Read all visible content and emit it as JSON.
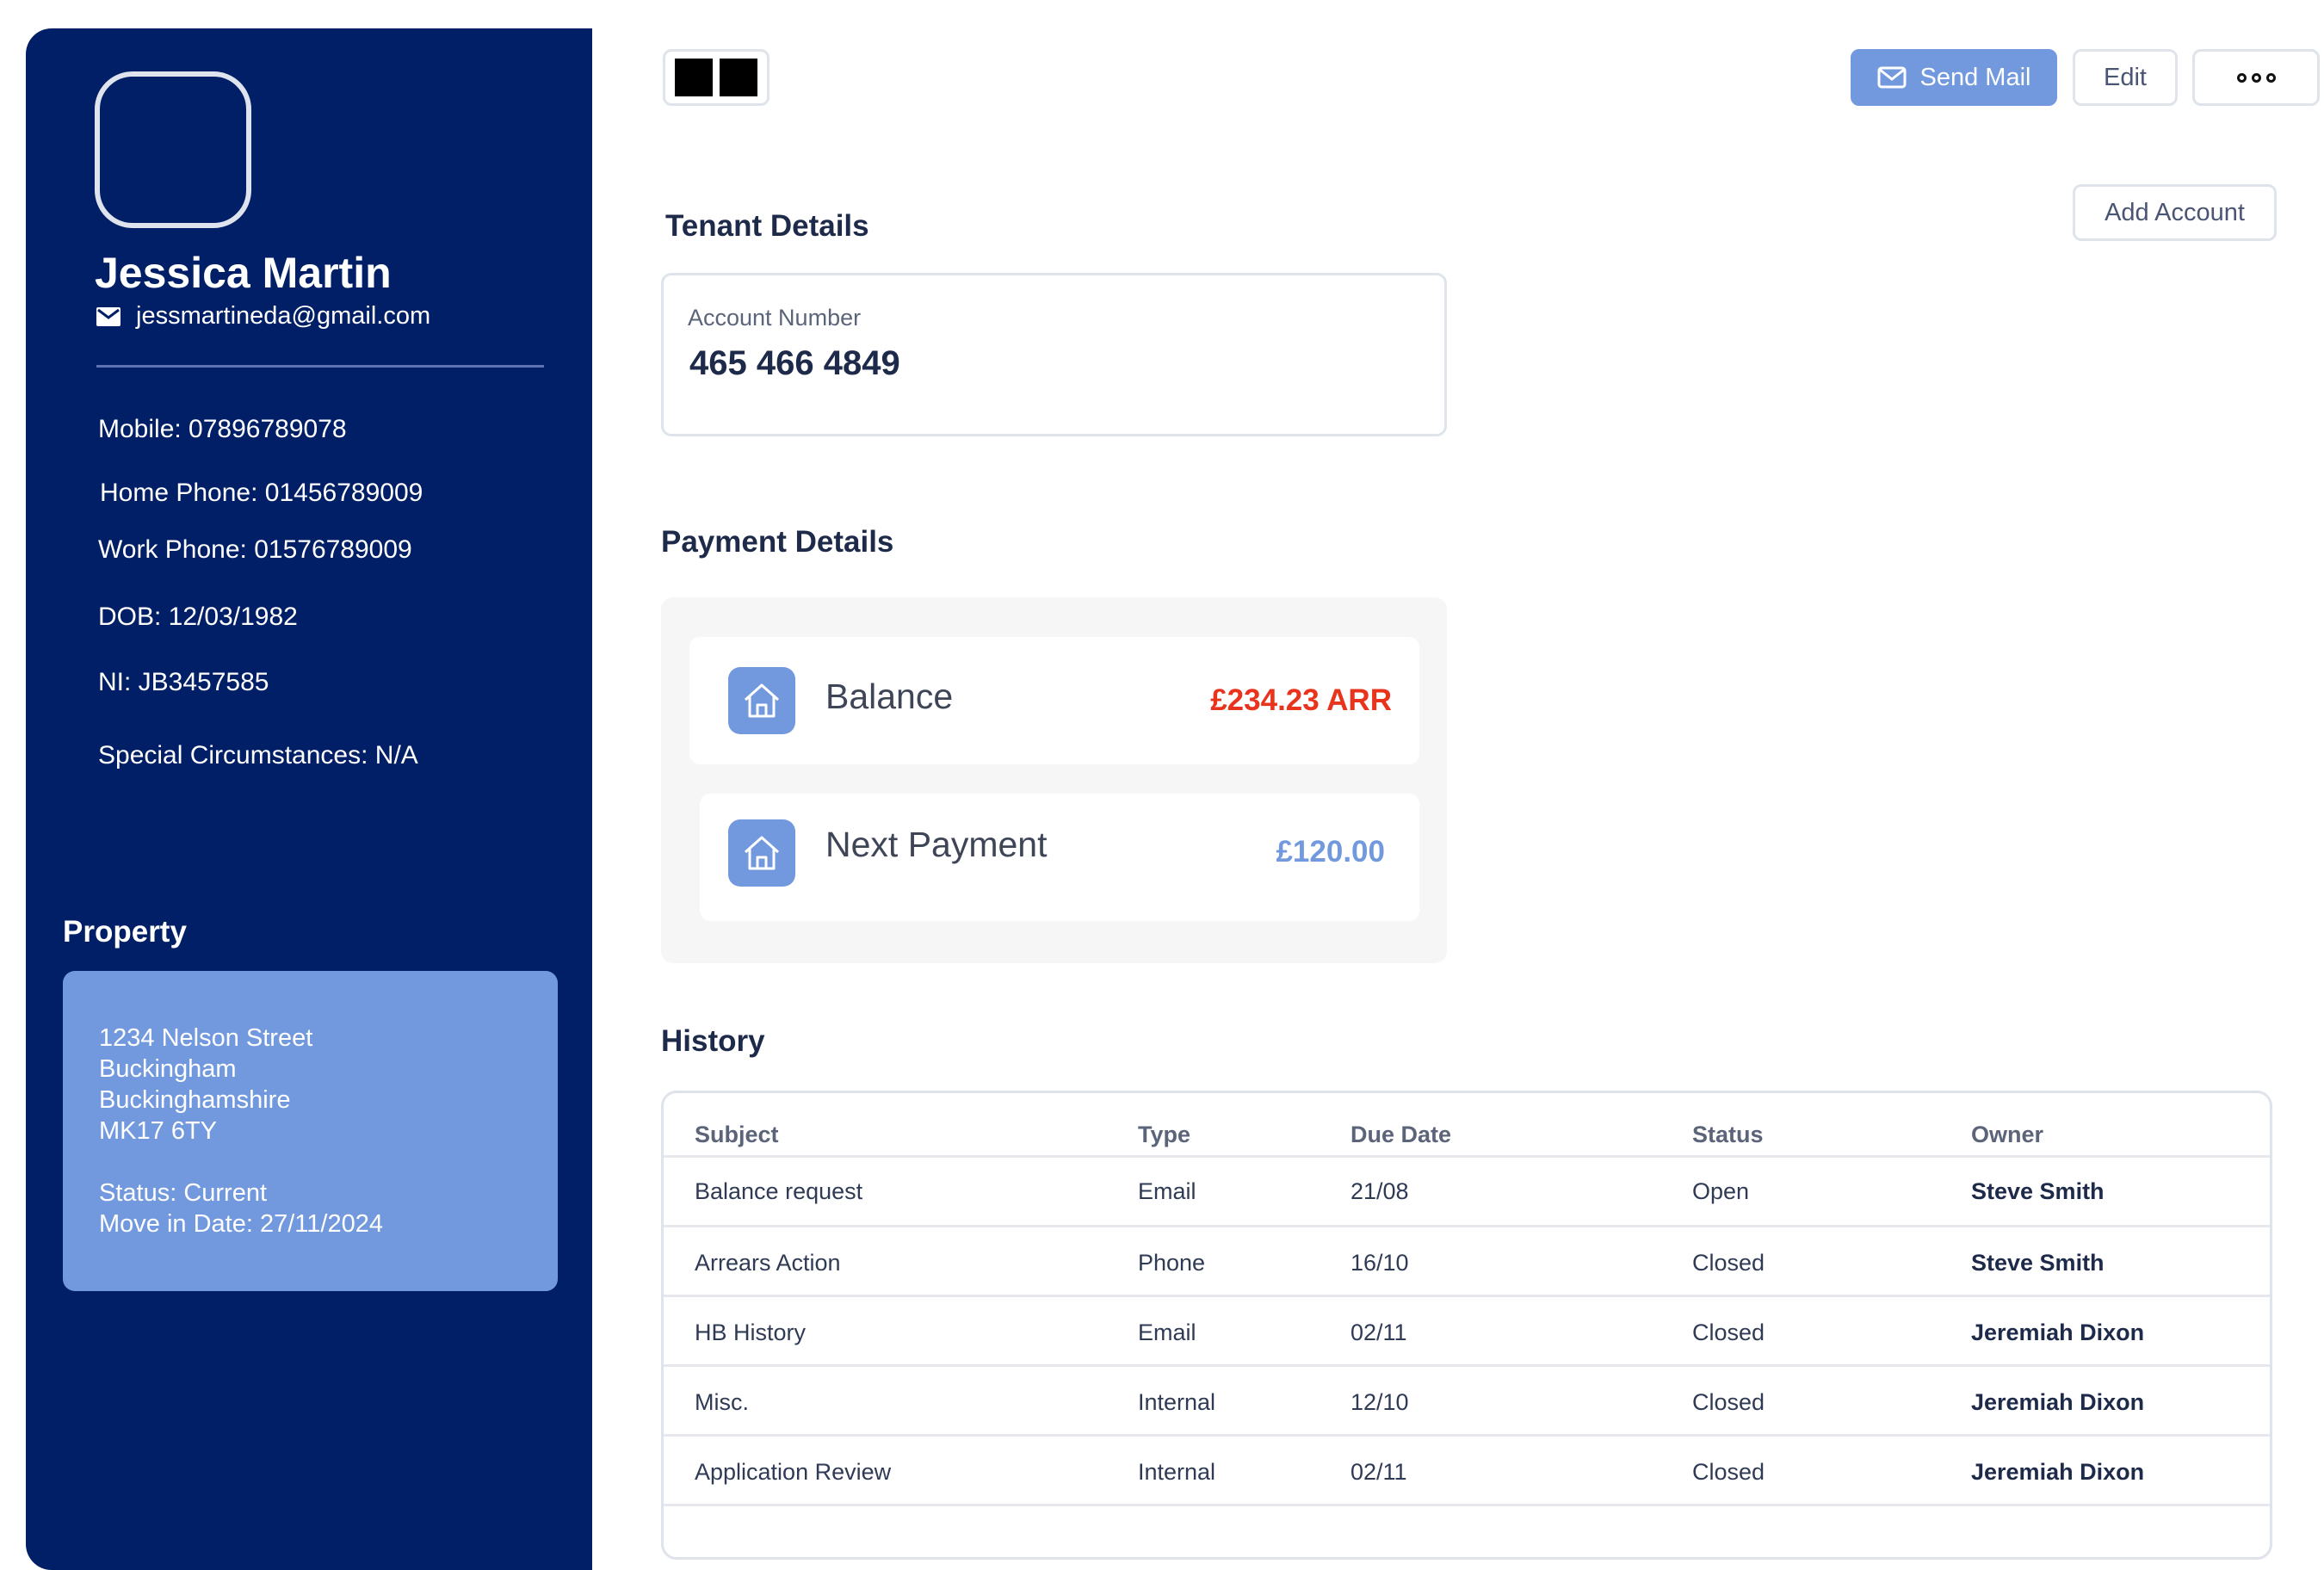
{
  "tenant": {
    "name": "Jessica Martin",
    "email": "jessmartineda@gmail.com",
    "mobile": "Mobile: 07896789078",
    "home_phone": "Home Phone: 01456789009",
    "work_phone": "Work Phone: 01576789009",
    "dob": "DOB: 12/03/1982",
    "ni": "NI: JB3457585",
    "special": "Special Circumstances: N/A"
  },
  "property": {
    "title": "Property",
    "address": [
      "1234 Nelson Street",
      "Buckingham",
      "Buckinghamshire",
      "MK17 6TY"
    ],
    "status": "Status: Current",
    "move_in": "Move in Date:  27/11/2024"
  },
  "toolbar": {
    "send_mail": "Send Mail",
    "edit": "Edit",
    "add_account": "Add Account"
  },
  "tenant_details": {
    "title": "Tenant Details",
    "account_label": "Account Number",
    "account_number": "465 466 4849"
  },
  "payment_details": {
    "title": "Payment Details",
    "balance_label": "Balance",
    "balance_value": "£234.23  ARR",
    "next_label": "Next Payment",
    "next_value": "£120.00"
  },
  "history": {
    "title": "History",
    "columns": [
      "Subject",
      "Type",
      "Due Date",
      "Status",
      "Owner"
    ],
    "rows": [
      [
        "Balance request",
        "Email",
        "21/08",
        "Open",
        "Steve Smith"
      ],
      [
        "Arrears Action",
        "Phone",
        "16/10",
        "Closed",
        "Steve Smith"
      ],
      [
        "HB History",
        "Email",
        "02/11",
        "Closed",
        "Jeremiah Dixon"
      ],
      [
        "Misc.",
        "Internal",
        "12/10",
        "Closed",
        "Jeremiah Dixon"
      ],
      [
        "Application Review",
        "Internal",
        "02/11",
        "Closed",
        "Jeremiah Dixon"
      ]
    ]
  },
  "colors": {
    "sidebar": "#001f66",
    "accent": "#7299de",
    "arrears": "#e8341c"
  },
  "icons": [
    "mail-icon",
    "house-icon",
    "more-icon"
  ]
}
